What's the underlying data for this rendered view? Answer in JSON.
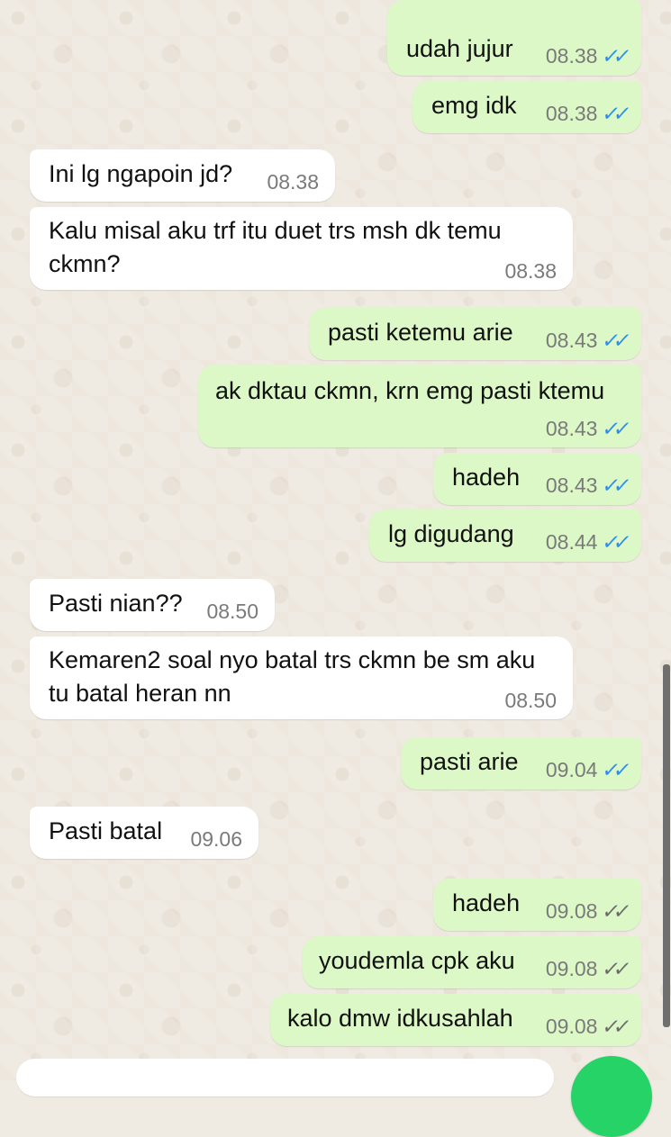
{
  "messages": [
    {
      "text": "udah jujur",
      "time": "08.38"
    },
    {
      "text": "emg idk",
      "time": "08.38"
    },
    {
      "text": "Ini lg ngapoin jd?",
      "time": "08.38"
    },
    {
      "text": "Kalu misal aku trf itu duet trs msh dk temu\nckmn?",
      "time": "08.38"
    },
    {
      "text": "pasti ketemu arie",
      "time": "08.43"
    },
    {
      "text": "ak dktau ckmn, krn emg pasti ktemu",
      "time": "08.43"
    },
    {
      "text": "hadeh",
      "time": "08.43"
    },
    {
      "text": "lg digudang",
      "time": "08.44"
    },
    {
      "text": "Pasti nian??",
      "time": "08.50"
    },
    {
      "text": "Kemaren2 soal nyo batal trs ckmn be sm aku\ntu batal heran nn",
      "time": "08.50"
    },
    {
      "text": "pasti arie",
      "time": "09.04"
    },
    {
      "text": "Pasti batal",
      "time": "09.06"
    },
    {
      "text": "hadeh",
      "time": "09.08"
    },
    {
      "text": "youdemla cpk aku",
      "time": "09.08"
    },
    {
      "text": "kalo dmw idkusahlah",
      "time": "09.08"
    }
  ],
  "icons": {
    "read_receipt": "double-check-read-icon",
    "sent_receipt": "double-check-sent-icon"
  },
  "colors": {
    "background": "#efeae2",
    "outgoing_bubble": "#dcf8c6",
    "incoming_bubble": "#ffffff",
    "read_tick": "#2c8df1",
    "sent_tick": "#6b6b6b",
    "fab": "#25d366"
  }
}
